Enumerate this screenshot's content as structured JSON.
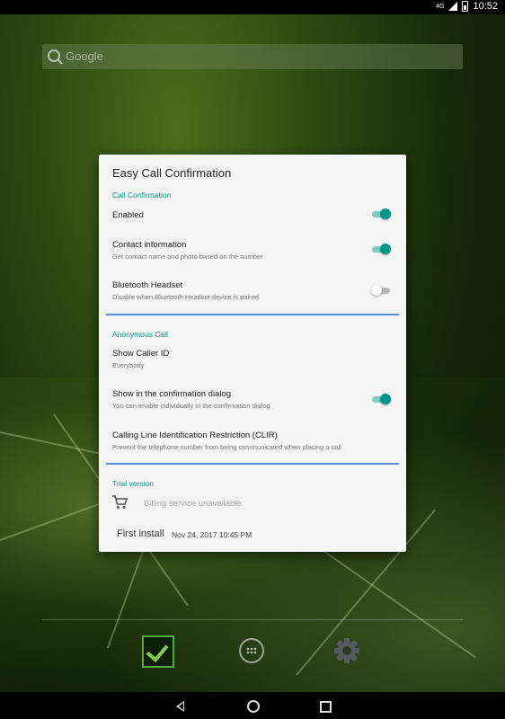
{
  "status_bar": {
    "network": "4G",
    "time": "10:52"
  },
  "search": {
    "placeholder": "Google"
  },
  "dialog": {
    "title": "Easy Call Confirmation",
    "sections": [
      {
        "header": "Call Confirmation",
        "items": [
          {
            "title": "Enabled",
            "summary": "",
            "switch": true
          },
          {
            "title": "Contact information",
            "summary": "Get contact name and photo based on the number",
            "switch": true
          },
          {
            "title": "Bluetooth Headset",
            "summary": "Disable when Bluetooth Headset device is paired",
            "switch": false
          }
        ]
      },
      {
        "header": "Anonymous Call",
        "items": [
          {
            "title": "Show Caller ID",
            "summary": "Everybody"
          },
          {
            "title": "Show in the confirmation dialog",
            "summary": "You can enable individually in the confirmation dialog",
            "switch": true
          },
          {
            "title": "Calling Line Identification Restriction (CLIR)",
            "summary": "Prevent the telephone number from being communicated when placing a call"
          }
        ]
      },
      {
        "header": "Trial version",
        "billing": "Billing service unavailable",
        "first_install_label": "First install",
        "first_install_value": "Nov 24, 2017 10:45 PM"
      }
    ]
  },
  "dock": {
    "icons": [
      "app-check-icon",
      "all-apps-icon",
      "settings-gear-icon"
    ]
  },
  "colors": {
    "accent": "#009688",
    "divider": "#5a8fd8"
  }
}
